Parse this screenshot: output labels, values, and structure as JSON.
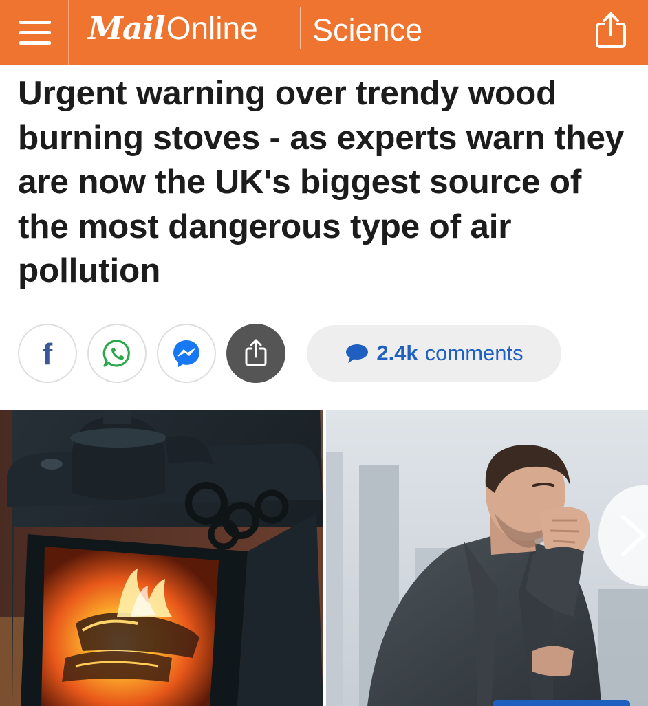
{
  "header": {
    "logo_mail": "Mail",
    "logo_online": "Online",
    "section": "Science",
    "brand_color": "#ee7430"
  },
  "icons": {
    "menu": "menu-icon",
    "share": "share-icon",
    "facebook": "facebook-icon",
    "whatsapp": "whatsapp-icon",
    "messenger": "messenger-icon",
    "comment": "comment-bubble-icon",
    "next": "chevron-right-icon"
  },
  "article": {
    "headline": "Urgent warning over trendy wood burning stoves - as experts warn they are now the UK's biggest source of the most dangerous type of air pollution"
  },
  "share_bar": {
    "facebook_label": "f",
    "comments_count": "2.4k",
    "comments_label": "comments",
    "comments_color": "#1f5fbf"
  },
  "gallery": {
    "images": [
      {
        "subject": "wood burning stove with fire and kettle"
      },
      {
        "subject": "man in dark coat coughing into fist"
      }
    ]
  }
}
